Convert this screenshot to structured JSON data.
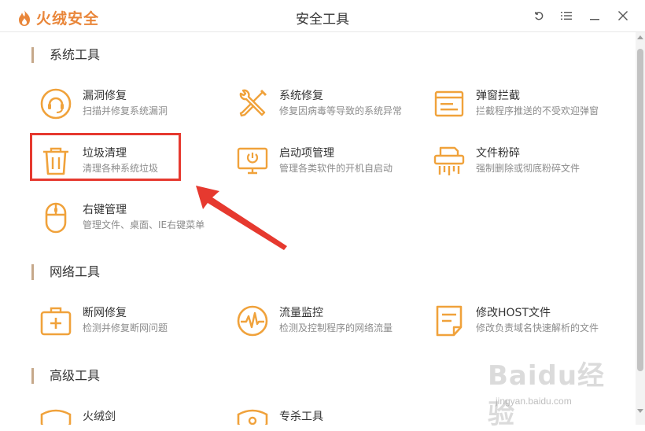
{
  "app": {
    "name": "火绒安全",
    "window_title": "安全工具"
  },
  "window_controls": [
    {
      "icon": "refresh-icon"
    },
    {
      "icon": "menu-icon"
    },
    {
      "icon": "minimize-icon"
    },
    {
      "icon": "close-icon"
    }
  ],
  "sections": [
    {
      "title": "系统工具",
      "tools": [
        {
          "icon": "bug-fix-icon",
          "name": "漏洞修复",
          "desc": "扫描并修复系统漏洞"
        },
        {
          "icon": "wrench-icon",
          "name": "系统修复",
          "desc": "修复因病毒等导致的系统异常"
        },
        {
          "icon": "popup-block-icon",
          "name": "弹窗拦截",
          "desc": "拦截程序推送的不受欢迎弹窗"
        },
        {
          "icon": "trash-icon",
          "name": "垃圾清理",
          "desc": "清理各种系统垃圾"
        },
        {
          "icon": "startup-monitor-icon",
          "name": "启动项管理",
          "desc": "管理各类软件的开机自启动"
        },
        {
          "icon": "shredder-icon",
          "name": "文件粉碎",
          "desc": "强制删除或彻底粉碎文件"
        },
        {
          "icon": "mouse-icon",
          "name": "右键管理",
          "desc": "管理文件、桌面、IE右键菜单"
        }
      ]
    },
    {
      "title": "网络工具",
      "tools": [
        {
          "icon": "network-repair-icon",
          "name": "断网修复",
          "desc": "检测并修复断网问题"
        },
        {
          "icon": "traffic-monitor-icon",
          "name": "流量监控",
          "desc": "检测及控制程序的网络流量"
        },
        {
          "icon": "host-file-icon",
          "name": "修改HOST文件",
          "desc": "修改负责域名快速解析的文件"
        }
      ]
    },
    {
      "title": "高级工具",
      "tools": [
        {
          "icon": "sword-icon",
          "name": "火绒剑",
          "desc": ""
        },
        {
          "icon": "expert-icon",
          "name": "专杀工具",
          "desc": ""
        }
      ]
    }
  ],
  "watermark": {
    "main": "Baidu经验",
    "sub": "jingyan.baidu.com"
  },
  "colors": {
    "accent": "#e9863a",
    "icon": "#f0a23b",
    "highlight": "#e6392f"
  }
}
